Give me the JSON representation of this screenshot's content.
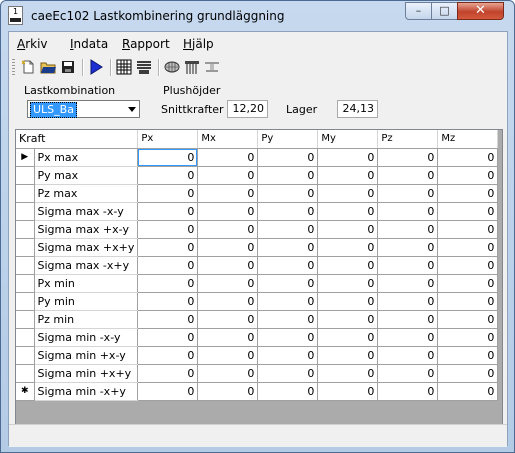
{
  "window": {
    "title": "caeEc102 Lastkombinering grundläggning",
    "icon_label": "1",
    "buttons": {
      "minimize": "–",
      "maximize": "□",
      "close": "✕"
    }
  },
  "menu": [
    {
      "label": "Arkiv",
      "underline": "A",
      "rest": "rkiv"
    },
    {
      "label": "Indata",
      "underline": "I",
      "rest": "ndata"
    },
    {
      "label": "Rapport",
      "underline": "R",
      "rest": "apport"
    },
    {
      "label": "Hjälp",
      "underline": "H",
      "rest": "jälp"
    }
  ],
  "toolbar": {
    "icons": [
      "new-file-icon",
      "open-folder-icon",
      "save-disk-icon",
      "run-arrow-icon",
      "grid-table-icon",
      "list-lines-icon",
      "mesh-shape-icon",
      "pile-foundation-icon",
      "beam-support-icon"
    ]
  },
  "lastkombination": {
    "group_label": "Lastkombination",
    "selected": "ULS_Ba"
  },
  "plushojder": {
    "group_label": "Plushöjder",
    "snittkrafter_label": "Snittkrafter",
    "snittkrafter_value": "12,20",
    "lager_label": "Lager",
    "lager_value": "24,13"
  },
  "grid": {
    "columns": [
      "Kraft",
      "Px",
      "Mx",
      "Py",
      "My",
      "Pz",
      "Mz"
    ],
    "rows": [
      {
        "marker": "▶",
        "kraft": "Px max",
        "values": [
          "0",
          "0",
          "0",
          "0",
          "0",
          "0"
        ]
      },
      {
        "marker": "",
        "kraft": "Py max",
        "values": [
          "0",
          "0",
          "0",
          "0",
          "0",
          "0"
        ]
      },
      {
        "marker": "",
        "kraft": "Pz max",
        "values": [
          "0",
          "0",
          "0",
          "0",
          "0",
          "0"
        ]
      },
      {
        "marker": "",
        "kraft": "Sigma max -x-y",
        "values": [
          "0",
          "0",
          "0",
          "0",
          "0",
          "0"
        ]
      },
      {
        "marker": "",
        "kraft": "Sigma max +x-y",
        "values": [
          "0",
          "0",
          "0",
          "0",
          "0",
          "0"
        ]
      },
      {
        "marker": "",
        "kraft": "Sigma max +x+y",
        "values": [
          "0",
          "0",
          "0",
          "0",
          "0",
          "0"
        ]
      },
      {
        "marker": "",
        "kraft": "Sigma max -x+y",
        "values": [
          "0",
          "0",
          "0",
          "0",
          "0",
          "0"
        ]
      },
      {
        "marker": "",
        "kraft": "Px min",
        "values": [
          "0",
          "0",
          "0",
          "0",
          "0",
          "0"
        ]
      },
      {
        "marker": "",
        "kraft": "Py min",
        "values": [
          "0",
          "0",
          "0",
          "0",
          "0",
          "0"
        ]
      },
      {
        "marker": "",
        "kraft": "Pz min",
        "values": [
          "0",
          "0",
          "0",
          "0",
          "0",
          "0"
        ]
      },
      {
        "marker": "",
        "kraft": "Sigma min -x-y",
        "values": [
          "0",
          "0",
          "0",
          "0",
          "0",
          "0"
        ]
      },
      {
        "marker": "",
        "kraft": "Sigma min +x-y",
        "values": [
          "0",
          "0",
          "0",
          "0",
          "0",
          "0"
        ]
      },
      {
        "marker": "",
        "kraft": "Sigma min +x+y",
        "values": [
          "0",
          "0",
          "0",
          "0",
          "0",
          "0"
        ]
      },
      {
        "marker": "✱",
        "kraft": "Sigma min -x+y",
        "values": [
          "0",
          "0",
          "0",
          "0",
          "0",
          "0"
        ]
      }
    ]
  },
  "colors": {
    "selection": "#3399ff",
    "grid_background": "#ababab",
    "title_gradient": "#c6d9ef"
  }
}
